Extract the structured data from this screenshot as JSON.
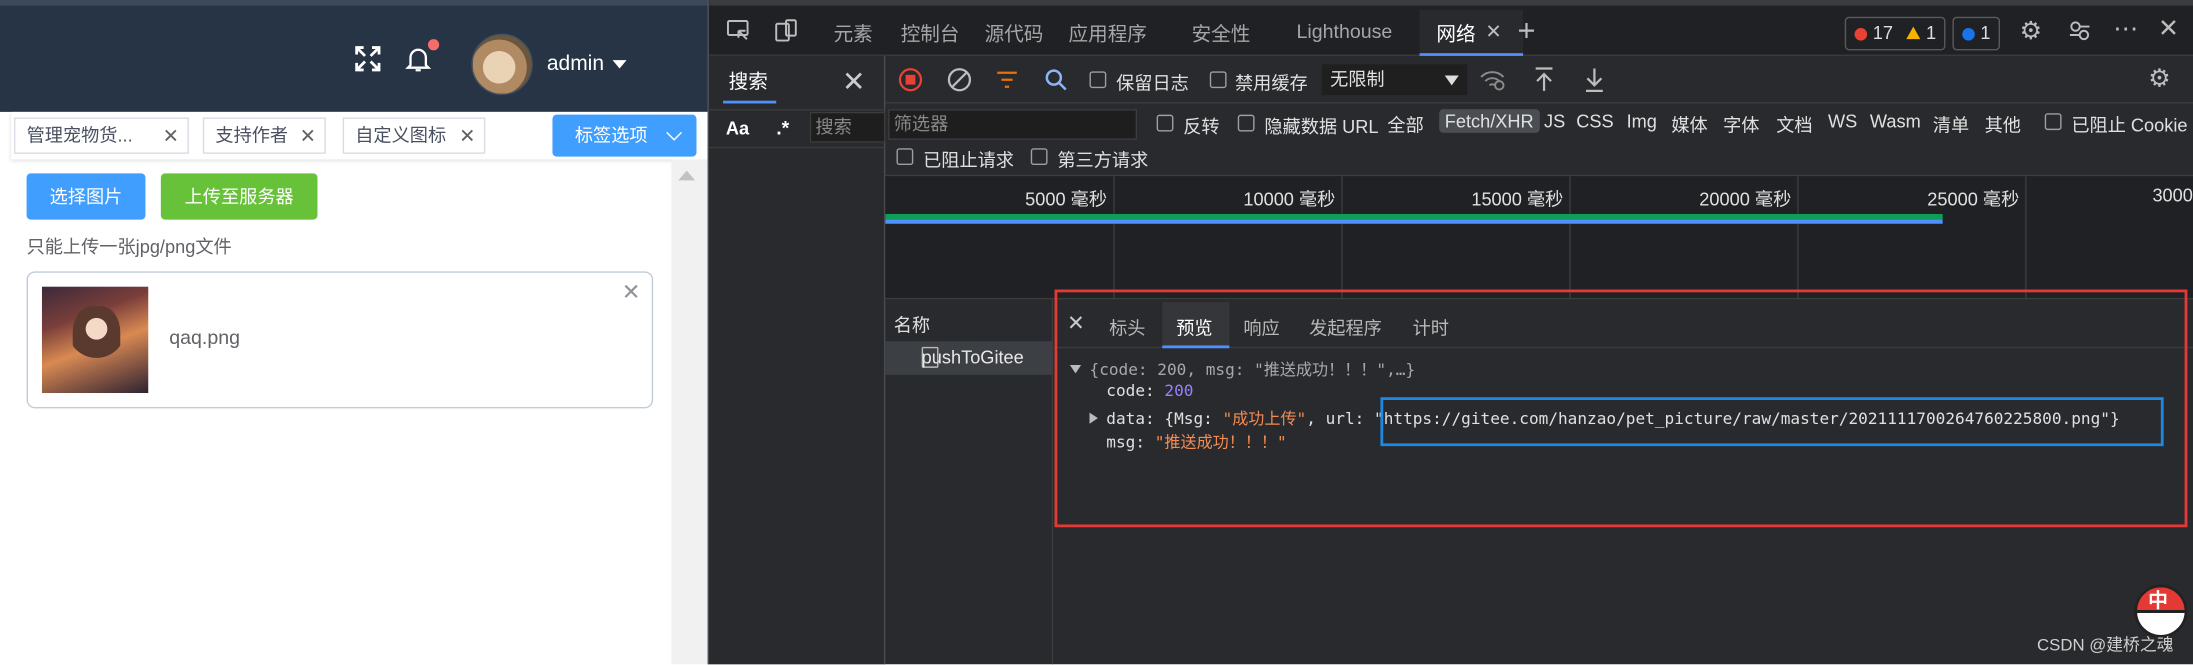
{
  "app": {
    "header": {
      "username": "admin"
    },
    "tags": [
      {
        "label": "管理宠物货..."
      },
      {
        "label": "支持作者"
      },
      {
        "label": "自定义图标"
      }
    ],
    "tag_options_label": "标签选项",
    "select_image_label": "选择图片",
    "upload_label": "上传至服务器",
    "upload_tip": "只能上传一张jpg/png文件",
    "file_name": "qaq.png",
    "colors": {
      "primary": "#409eff",
      "success": "#67c23a",
      "header": "#263445"
    }
  },
  "devtools": {
    "tabs": [
      "元素",
      "控制台",
      "源代码",
      "应用程序",
      "安全性",
      "Lighthouse",
      "网络"
    ],
    "active_tab": "网络",
    "errors": "17",
    "warnings": "1",
    "messages": "1",
    "search": {
      "title": "搜索",
      "aa": "Aa",
      "regex": ".*",
      "placeholder": "搜索"
    },
    "toolbar": {
      "preserve_log": "保留日志",
      "disable_cache": "禁用缓存",
      "throttle": "无限制"
    },
    "filter": {
      "placeholder": "筛选器",
      "invert": "反转",
      "hide_data_urls": "隐藏数据 URL",
      "all": "全部",
      "types": [
        "Fetch/XHR",
        "JS",
        "CSS",
        "Img",
        "媒体",
        "字体",
        "文档",
        "WS",
        "Wasm",
        "清单",
        "其他"
      ],
      "blocked_cookies": "已阻止 Cookie",
      "blocked_requests": "已阻止请求",
      "third_party": "第三方请求"
    },
    "timeline": {
      "labels": [
        "5000 毫秒",
        "10000 毫秒",
        "15000 毫秒",
        "20000 毫秒",
        "25000 毫秒",
        "3000"
      ],
      "request_end_ms": 23200
    },
    "names_header": "名称",
    "request_name": "pushToGitee",
    "detail_tabs": [
      "标头",
      "预览",
      "响应",
      "发起程序",
      "计时"
    ],
    "active_detail_tab": "预览",
    "preview": {
      "summary": "{code: 200, msg: \"推送成功！！！\",…}",
      "code_key": "code: ",
      "code_val": "200",
      "data_key": "data: ",
      "data_open": "{Msg: ",
      "msg_val": "\"成功上传\"",
      "url_key": ", url: ",
      "url_val": "\"https://gitee.com/hanzao/pet_picture/raw/master/20211117002647602258​00.png\"",
      "data_close": "}",
      "msg_key": "msg: ",
      "msg_str": "\"推送成功！！！\""
    }
  },
  "overlay": {
    "watermark": "CSDN @建桥之魂",
    "ime_char": "中"
  }
}
